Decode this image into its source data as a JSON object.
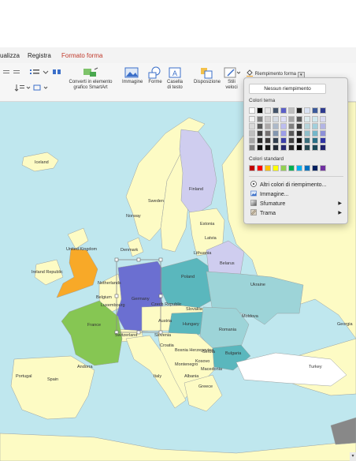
{
  "tabs": [
    {
      "label": "ualizza"
    },
    {
      "label": "Registra"
    },
    {
      "label": "Formato forma",
      "active": true
    }
  ],
  "ribbon": {
    "smartart": "Converti in elemento grafico SmartArt",
    "smartart_line2": "grafico SmartArt",
    "smartart_line1": "Converti in elemento",
    "immagine": "Immagine",
    "forme": "Forme",
    "casella_line1": "Casella",
    "casella_line2": "di testo",
    "disposizione": "Disposizione",
    "stili_line1": "Stili",
    "stili_line2": "veloci",
    "riempimento": "Riempimento forma"
  },
  "dropdown": {
    "no_fill": "Nessun riempimento",
    "theme_colors_label": "Colori tema",
    "standard_colors_label": "Colori standard",
    "more_colors": "Altri colori di riempimento...",
    "image": "Immagine...",
    "gradient": "Sfumature",
    "texture": "Trama",
    "theme_colors": [
      [
        "#ffffff",
        "#000000",
        "#e7e6e6",
        "#44546a",
        "#5b5fc7",
        "#bfbfbf",
        "#222222",
        "#d9e2f3",
        "#3c5a9a",
        "#2f3b8f"
      ],
      [
        "#f2f2f2",
        "#7f7f7f",
        "#d0cece",
        "#d6dce5",
        "#dedff7",
        "#a6a6a6",
        "#595959",
        "#dbe9ec",
        "#d0e8ee",
        "#d9daf2"
      ],
      [
        "#d9d9d9",
        "#595959",
        "#aeaaaa",
        "#adb9ca",
        "#bdbef0",
        "#808080",
        "#404040",
        "#b4d3da",
        "#a2cfdc",
        "#b3b5e5"
      ],
      [
        "#bfbfbf",
        "#3f3f3f",
        "#757171",
        "#8497b0",
        "#9c9de8",
        "#595959",
        "#262626",
        "#8ebec9",
        "#74b7ca",
        "#8d90d8"
      ],
      [
        "#a6a6a6",
        "#262626",
        "#3b3838",
        "#323f4f",
        "#3b3fa8",
        "#404040",
        "#0d0d0d",
        "#3a6f7c",
        "#2a6f86",
        "#3034a3"
      ],
      [
        "#7f7f7f",
        "#0d0d0d",
        "#171616",
        "#222a35",
        "#272a70",
        "#262626",
        "#000000",
        "#274a53",
        "#1c4a59",
        "#20236d"
      ]
    ],
    "standard_colors": [
      "#c00000",
      "#ff0000",
      "#ffc000",
      "#ffff00",
      "#92d050",
      "#00b050",
      "#00b0f0",
      "#0070c0",
      "#002060",
      "#7030a0"
    ]
  },
  "map": {
    "colors": {
      "sea": "#bfe7ee",
      "land": "#fdfbc4",
      "england": "#f8a928",
      "france": "#86c653",
      "germany": "#6b6fd1",
      "finland": "#cfcdef",
      "belarus": "#cfcdef",
      "poland": "#5ab7bd",
      "ukraine": "#9dd4d8",
      "hungary": "#5ab7bd",
      "romania": "#9dd4d8",
      "bulgaria": "#5ab7bd",
      "turkey": "#ffffff",
      "gray": "#888888"
    },
    "labels": {
      "iceland": "Iceland",
      "norway": "Norway",
      "sweden": "Sweden",
      "finland": "Finland",
      "estonia": "Estonia",
      "latvia": "Latvia",
      "lithuania": "Lithuania",
      "denmark": "Denmark",
      "united_kingdom": "United Kingdom",
      "ireland": "Ireland Republic",
      "netherlands": "Netherlands",
      "belgium": "Belgium",
      "luxembourg": "Luxembourg",
      "germany": "Germany",
      "poland": "Poland",
      "belarus": "Belarus",
      "ukraine": "Ukraine",
      "czech": "Czech Republic",
      "slovakia": "Slovakia",
      "austria": "Austria",
      "hungary": "Hungary",
      "moldova": "Moldova",
      "romania": "Romania",
      "france": "France",
      "switzerland": "Switzerland",
      "slovenia": "Slovenia",
      "croatia": "Croatia",
      "bosnia": "Bosnia Herzegovina",
      "serbia": "Serbia",
      "bulgaria": "Bulgaria",
      "montenegro": "Montenegro",
      "kosovo": "Kosovo",
      "macedonia": "Macedonia",
      "albania": "Albania",
      "italy": "Italy",
      "greece": "Greece",
      "andorra": "Andorra",
      "portugal": "Portugal",
      "spain": "Spain",
      "turkey": "Turkey",
      "georgia": "Georgia"
    }
  }
}
